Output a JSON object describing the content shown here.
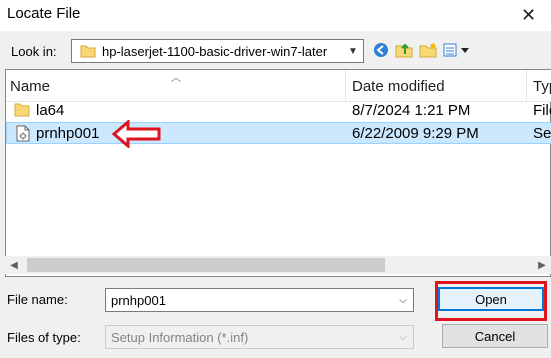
{
  "window": {
    "title": "Locate File",
    "close_glyph": "✕"
  },
  "toolbar": {
    "lookin_label": "Look in:",
    "lookin_value": "hp-laserjet-1100-basic-driver-win7-later",
    "icons": [
      "back-icon",
      "up-folder-icon",
      "new-folder-icon",
      "view-menu-icon"
    ]
  },
  "list": {
    "columns": [
      "Name",
      "Date modified",
      "Typ"
    ],
    "rows": [
      {
        "name": "la64",
        "date": "8/7/2024 1:21 PM",
        "type": "File",
        "icon": "folder-icon",
        "selected": false
      },
      {
        "name": "prnhp001",
        "date": "6/22/2009 9:29 PM",
        "type": "Set",
        "icon": "setup-file-icon",
        "selected": true
      }
    ]
  },
  "form": {
    "filename_label": "File name:",
    "filename_value": "prnhp001",
    "filetype_label": "Files of type:",
    "filetype_value": "Setup Information (*.inf)"
  },
  "buttons": {
    "open": "Open",
    "cancel": "Cancel"
  },
  "colors": {
    "selection": "#cce8ff",
    "annotation": "#e0141e",
    "accent": "#0078d7"
  }
}
